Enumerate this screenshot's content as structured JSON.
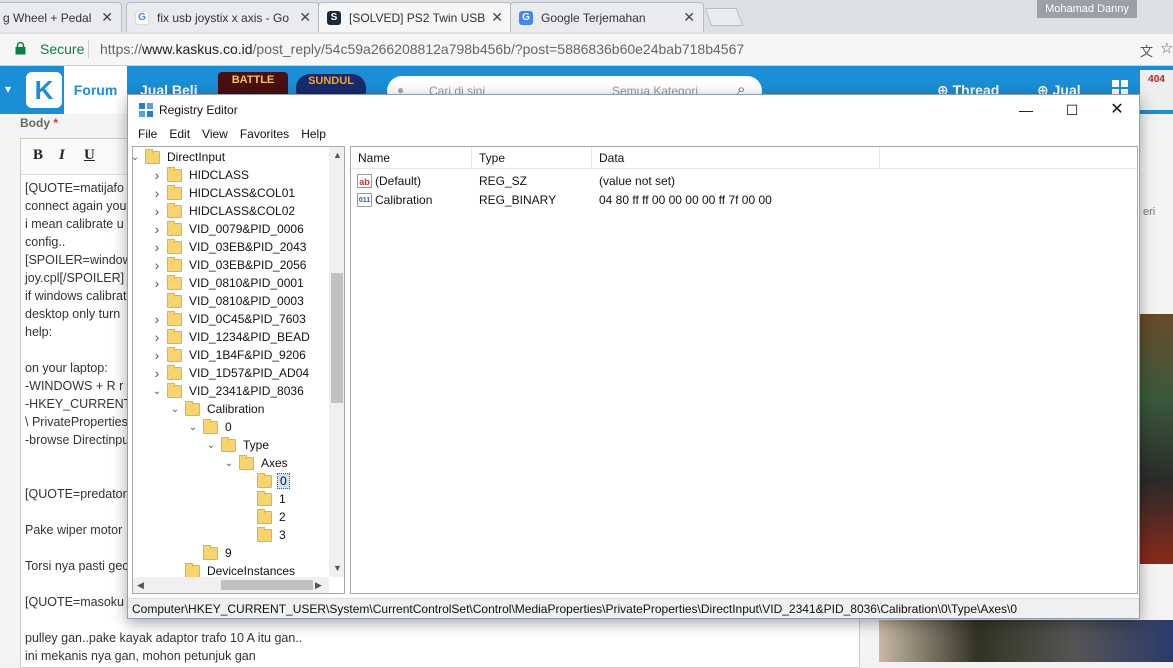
{
  "browser": {
    "tabs": [
      {
        "title": "g Wheel + Pedal g",
        "icon": "none"
      },
      {
        "title": "fix usb joystix x axis - Go",
        "icon": "google-icon"
      },
      {
        "title": "[SOLVED] PS2 Twin USB (",
        "icon": "steam-icon"
      },
      {
        "title": "Google Terjemahan",
        "icon": "google-translate-icon"
      }
    ],
    "user": "Mohamad Danny",
    "secure_label": "Secure",
    "url_scheme": "https://",
    "url_host": "www.kaskus.co.id",
    "url_path": "/post_reply/54c59a266208812a798b456b/?post=5886836b60e24bab718b4567"
  },
  "kaskus": {
    "logo": "K",
    "forum": "Forum",
    "jual_beli": "Jual Beli",
    "banner1": "BATTLE",
    "banner2": "SUNDUL",
    "search_placeholder": "Cari di sini",
    "search_category": "Semua Kategori",
    "thread_btn": "Thread",
    "jual_btn": "Jual",
    "avatar_text": "404",
    "right_text": "eri"
  },
  "editor": {
    "label": "Body",
    "required": "*",
    "bold": "B",
    "italic": "I",
    "underline": "U",
    "lines": [
      "[QUOTE=matijafo",
      "connect again you",
      "i mean calibrate u",
      "config..",
      "[SPOILER=window",
      "joy.cpl[/SPOILER]",
      "if windows calibrat",
      "desktop only turn",
      "help:",
      "",
      "on your laptop:",
      "-WINDOWS + R r",
      "-HKEY_CURRENT",
      "\\ PrivateProperties",
      "-browse Directinpu",
      "",
      "",
      "[QUOTE=predator",
      "",
      "Pake wiper motor",
      "",
      "Torsi nya pasti gec",
      "",
      "[QUOTE=masoku",
      "",
      "pulley gan..pake kayak adaptor trafo 10 A itu gan..",
      "ini mekanis nya gan, mohon petunjuk gan"
    ]
  },
  "regedit": {
    "title": "Registry Editor",
    "menu": [
      "File",
      "Edit",
      "View",
      "Favorites",
      "Help"
    ],
    "tree": [
      {
        "label": "DirectInput",
        "exp": "open"
      },
      {
        "label": "HIDCLASS",
        "exp": "closed"
      },
      {
        "label": "HIDCLASS&COL01",
        "exp": "closed"
      },
      {
        "label": "HIDCLASS&COL02",
        "exp": "closed"
      },
      {
        "label": "VID_0079&PID_0006",
        "exp": "closed"
      },
      {
        "label": "VID_03EB&PID_2043",
        "exp": "closed"
      },
      {
        "label": "VID_03EB&PID_2056",
        "exp": "closed"
      },
      {
        "label": "VID_0810&PID_0001",
        "exp": "closed"
      },
      {
        "label": "VID_0810&PID_0003",
        "exp": "none"
      },
      {
        "label": "VID_0C45&PID_7603",
        "exp": "closed"
      },
      {
        "label": "VID_1234&PID_BEAD",
        "exp": "closed"
      },
      {
        "label": "VID_1B4F&PID_9206",
        "exp": "closed"
      },
      {
        "label": "VID_1D57&PID_AD04",
        "exp": "closed"
      },
      {
        "label": "VID_2341&PID_8036",
        "exp": "open"
      },
      {
        "label": "Calibration",
        "exp": "open"
      },
      {
        "label": "0",
        "exp": "open"
      },
      {
        "label": "Type",
        "exp": "open"
      },
      {
        "label": "Axes",
        "exp": "open"
      },
      {
        "label": "0",
        "exp": "none"
      },
      {
        "label": "1",
        "exp": "none"
      },
      {
        "label": "2",
        "exp": "none"
      },
      {
        "label": "3",
        "exp": "none"
      },
      {
        "label": "9",
        "exp": "none"
      },
      {
        "label": "DeviceInstances",
        "exp": "none"
      }
    ],
    "columns": [
      "Name",
      "Type",
      "Data"
    ],
    "values": [
      {
        "name": "(Default)",
        "type": "REG_SZ",
        "data": "(value not set)",
        "icon": "ab"
      },
      {
        "name": "Calibration",
        "type": "REG_BINARY",
        "data": "04 80 ff ff 00 00 00 00 ff 7f 00 00",
        "icon": "011"
      }
    ],
    "status_path": "Computer\\HKEY_CURRENT_USER\\System\\CurrentControlSet\\Control\\MediaProperties\\PrivateProperties\\DirectInput\\VID_2341&PID_8036\\Calibration\\0\\Type\\Axes\\0"
  }
}
